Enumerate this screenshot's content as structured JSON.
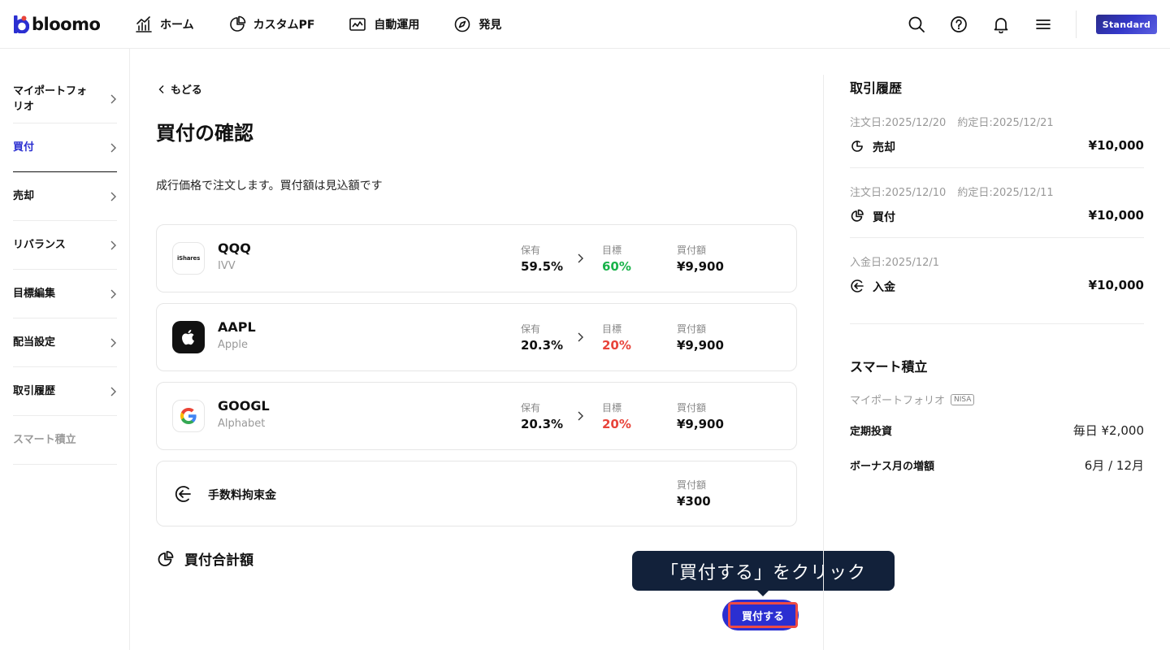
{
  "header": {
    "logo_text": "bloomo",
    "nav": [
      {
        "label": "ホーム",
        "icon": "chart-bar-icon"
      },
      {
        "label": "カスタムPF",
        "icon": "pie-chart-icon"
      },
      {
        "label": "自動運用",
        "icon": "line-chart-icon"
      },
      {
        "label": "発見",
        "icon": "compass-icon"
      }
    ],
    "plan_badge": "Standard"
  },
  "sidebar": {
    "items": [
      {
        "label": "マイポートフォリオ",
        "state": "normal"
      },
      {
        "label": "買付",
        "state": "active"
      },
      {
        "label": "売却",
        "state": "normal"
      },
      {
        "label": "リバランス",
        "state": "normal"
      },
      {
        "label": "目標編集",
        "state": "normal"
      },
      {
        "label": "配当設定",
        "state": "normal"
      },
      {
        "label": "取引履歴",
        "state": "normal"
      },
      {
        "label": "スマート積立",
        "state": "disabled"
      }
    ]
  },
  "main": {
    "back_label": "もどる",
    "title": "買付の確認",
    "subtitle": "成行価格で注文します。買付額は見込額です",
    "holdings_label": "保有",
    "target_label": "目標",
    "amount_label": "買付額",
    "rows": [
      {
        "ticker": "QQQ",
        "name": "IVV",
        "logo_text": "iShares",
        "holding": "59.5%",
        "target": "60%",
        "target_color": "green",
        "amount": "¥9,900"
      },
      {
        "ticker": "AAPL",
        "name": "Apple",
        "holding": "20.3%",
        "target": "20%",
        "target_color": "red",
        "amount": "¥9,900"
      },
      {
        "ticker": "GOOGL",
        "name": "Alphabet",
        "holding": "20.3%",
        "target": "20%",
        "target_color": "red",
        "amount": "¥9,900"
      }
    ],
    "fee": {
      "label": "手数料拘束金",
      "amount_label": "買付額",
      "amount": "¥300"
    },
    "total_label": "買付合計額",
    "tooltip": "「買付する」をクリック",
    "buy_button": "買付する"
  },
  "history": {
    "title": "取引履歴",
    "items": [
      {
        "date1": "注文日:2025/12/20",
        "date2": "約定日:2025/12/21",
        "type": "売却",
        "amount": "¥10,000"
      },
      {
        "date1": "注文日:2025/12/10",
        "date2": "約定日:2025/12/11",
        "type": "買付",
        "amount": "¥10,000"
      },
      {
        "date1": "入金日:2025/12/1",
        "date2": "",
        "type": "入金",
        "amount": "¥10,000"
      }
    ]
  },
  "smart": {
    "title": "スマート積立",
    "portfolio_label": "マイポートフォリオ",
    "nisa_badge": "NISA",
    "regular_label": "定期投資",
    "regular_value": "毎日 ¥2,000",
    "bonus_label": "ボーナス月の増額",
    "bonus_value": "6月 / 12月"
  },
  "colors": {
    "accent": "#2b2fd1",
    "green": "#19b34a",
    "red": "#e8433a",
    "tooltip_bg": "#12213a",
    "highlight": "#ee4a44"
  }
}
